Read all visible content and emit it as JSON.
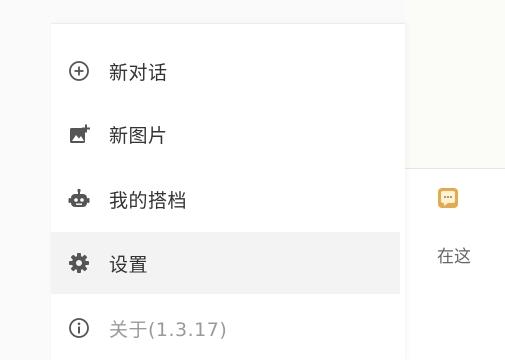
{
  "menu": {
    "items": [
      {
        "label": "新对话",
        "icon": "plus-circle-icon"
      },
      {
        "label": "新图片",
        "icon": "add-image-icon"
      },
      {
        "label": "我的搭档",
        "icon": "robot-icon"
      },
      {
        "label": "设置",
        "icon": "gear-icon",
        "active": true
      },
      {
        "label": "关于(1.3.17)",
        "icon": "info-icon"
      }
    ]
  },
  "chat": {
    "partial_text": "在这"
  },
  "colors": {
    "text": "#333333",
    "muted": "#9a9a9a",
    "active_bg": "#f3f3f3",
    "accent": "#e0a94a"
  }
}
